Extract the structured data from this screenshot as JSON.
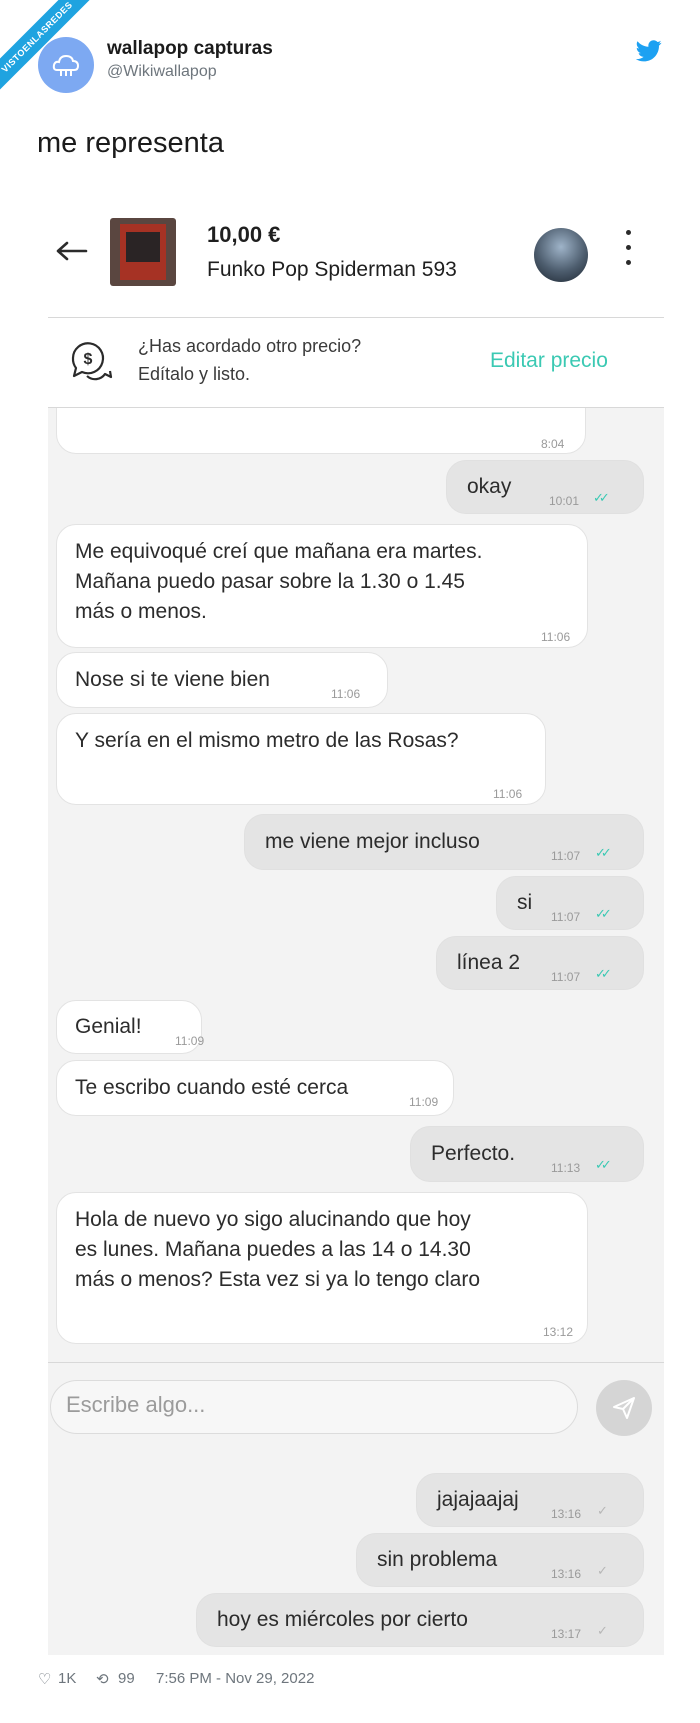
{
  "watermark": "VISTOENLASREDES",
  "tweet": {
    "author_name": "wallapop capturas",
    "author_handle": "@Wikiwallapop",
    "text": "me representa",
    "likes": "1K",
    "retweets": "99",
    "timestamp": "7:56 PM - Nov 29, 2022"
  },
  "chat_header": {
    "price": "10,00 €",
    "product": "Funko Pop Spiderman 593"
  },
  "banner": {
    "question": "¿Has acordado otro precio?",
    "subtitle": "Edítalo y listo.",
    "action": "Editar precio"
  },
  "messages": [
    {
      "from": "seller",
      "text": "",
      "time": "8:04"
    },
    {
      "from": "me",
      "text": "okay",
      "time": "10:01",
      "status": "read"
    },
    {
      "from": "seller",
      "text": "Me equivoqué creí que mañana era martes.\nMañana puedo pasar sobre la 1.30 o 1.45\nmás o menos.",
      "time": "11:06"
    },
    {
      "from": "seller",
      "text": "Nose si te viene bien",
      "time": "11:06"
    },
    {
      "from": "seller",
      "text": "Y sería en el mismo metro de las Rosas?",
      "time": "11:06"
    },
    {
      "from": "me",
      "text": "me viene mejor incluso",
      "time": "11:07",
      "status": "read"
    },
    {
      "from": "me",
      "text": "si",
      "time": "11:07",
      "status": "read"
    },
    {
      "from": "me",
      "text": "línea 2",
      "time": "11:07",
      "status": "read"
    },
    {
      "from": "seller",
      "text": "Genial!",
      "time": "11:09"
    },
    {
      "from": "seller",
      "text": "Te escribo cuando esté cerca",
      "time": "11:09"
    },
    {
      "from": "me",
      "text": "Perfecto.",
      "time": "11:13",
      "status": "read"
    },
    {
      "from": "seller",
      "text": "Hola de nuevo yo sigo alucinando que hoy\nes lunes. Mañana puedes a las 14 o 14.30\nmás o menos? Esta vez si ya lo tengo claro",
      "time": "13:12"
    },
    {
      "from": "me",
      "text": "jajajaajaj",
      "time": "13:16",
      "status": "sent"
    },
    {
      "from": "me",
      "text": "sin problema",
      "time": "13:16",
      "status": "sent"
    },
    {
      "from": "me",
      "text": "hoy es miércoles por cierto",
      "time": "13:17",
      "status": "sent"
    }
  ],
  "composer": {
    "placeholder": "Escribe algo..."
  },
  "colors": {
    "accent": "#3bc9b3",
    "twitter_blue": "#1da1f2",
    "avatar_bg": "#7da9f2"
  }
}
